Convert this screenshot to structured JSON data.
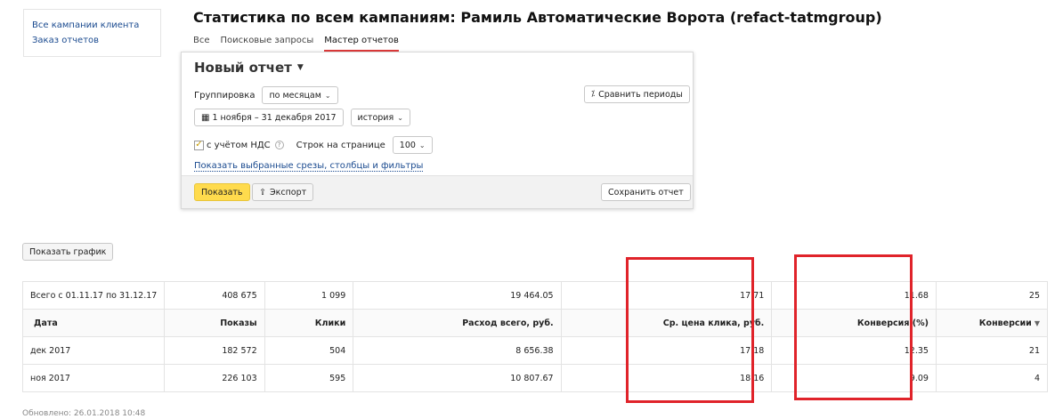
{
  "sidebar": {
    "links": [
      "Все кампании клиента",
      "Заказ отчетов"
    ]
  },
  "page_title": "Статистика по всем кампаниям: Рамиль Автоматические Ворота (refact-tatmgroup)",
  "tabs": [
    {
      "label": "Все",
      "active": false
    },
    {
      "label": "Поисковые запросы",
      "active": false
    },
    {
      "label": "Мастер отчетов",
      "active": true
    }
  ],
  "report": {
    "title": "Новый отчет",
    "grouping_label": "Группировка",
    "grouping_value": "по месяцам",
    "compare_label": "Сравнить периоды",
    "date_range": "1 ноября – 31 декабря 2017",
    "history_label": "история",
    "vat_label": "с учётом НДС",
    "vat_checked": true,
    "rows_per_page_label": "Строк на странице",
    "rows_per_page_value": "100",
    "show_filters_link": "Показать выбранные срезы, столбцы и фильтры",
    "show_button": "Показать",
    "export_button": "Экспорт",
    "save_button": "Сохранить отчет"
  },
  "show_chart_button": "Показать график",
  "table": {
    "total_row": [
      "Всего с 01.11.17 по 31.12.17",
      "408 675",
      "1 099",
      "19 464.05",
      "17.71",
      "11.68",
      "25"
    ],
    "headers": [
      "Дата",
      "Показы",
      "Клики",
      "Расход всего, руб.",
      "Ср. цена клика, руб.",
      "Конверсия (%)",
      "Конверсии"
    ],
    "rows": [
      [
        "дек 2017",
        "182 572",
        "504",
        "8 656.38",
        "17.18",
        "12.35",
        "21"
      ],
      [
        "ноя 2017",
        "226 103",
        "595",
        "10 807.67",
        "18.16",
        "9.09",
        "4"
      ]
    ]
  },
  "updated_text": "Обновлено: 26.01.2018 10:48",
  "colors": {
    "accent_yellow": "#ffdb4d",
    "link_blue": "#1a4a8f",
    "highlight_red": "#e0232a",
    "tab_underline": "#e03a3a"
  }
}
